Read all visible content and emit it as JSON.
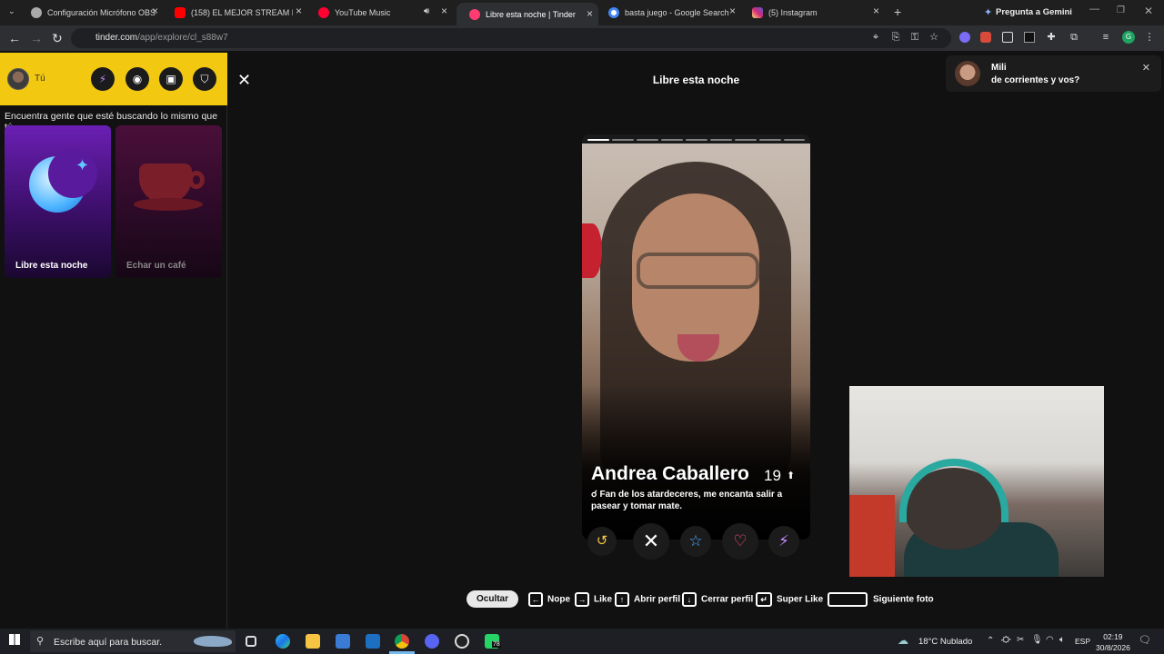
{
  "browser": {
    "tabs": [
      {
        "title": "Configuración Micrófono OBS",
        "color": "#bbbbbb"
      },
      {
        "title": "(158) EL MEJOR STREAM BOLIC",
        "color": "#ff0000"
      },
      {
        "title": "YouTube Music",
        "color": "#ff0033"
      },
      {
        "title": "Libre esta noche | Tinder",
        "color": "#fe3c72"
      },
      {
        "title": "basta juego - Google Search",
        "color": "#4285f4"
      },
      {
        "title": "(5) Instagram",
        "color": "#d6249f"
      }
    ],
    "new_tab": "+",
    "gemini_label": "Pregunta a Gemini",
    "url_host": "tinder.com",
    "url_path": "/app/explore/cl_s88w7",
    "profile_initial": "G"
  },
  "sidebar": {
    "user_label": "Tú",
    "intro": "Encuentra gente que esté buscando lo mismo que tú",
    "cards": [
      {
        "label": "Libre esta noche"
      },
      {
        "label": "Echar un café"
      }
    ]
  },
  "main": {
    "title": "Libre esta noche",
    "profile": {
      "name": "Andrea Caballero",
      "age": "19",
      "bio_icon": "☌",
      "bio": "Fan de los atardeceres, me encanta salir a pasear y tomar mate."
    },
    "hints": {
      "hide": "Ocultar",
      "nope": "Nope",
      "like": "Like",
      "open_profile": "Abrir perfil",
      "close_profile": "Cerrar perfil",
      "super_like": "Super Like",
      "next_photo": "Siguiente foto"
    }
  },
  "notification": {
    "name": "Mili",
    "message": "de corrientes y vos?"
  },
  "taskbar": {
    "search_placeholder": "Escribe aquí para buscar.",
    "whatsapp_badge": "78",
    "weather": "18°C  Nublado",
    "lang": "ESP",
    "time": "02:19",
    "date": "30/8/2026"
  }
}
